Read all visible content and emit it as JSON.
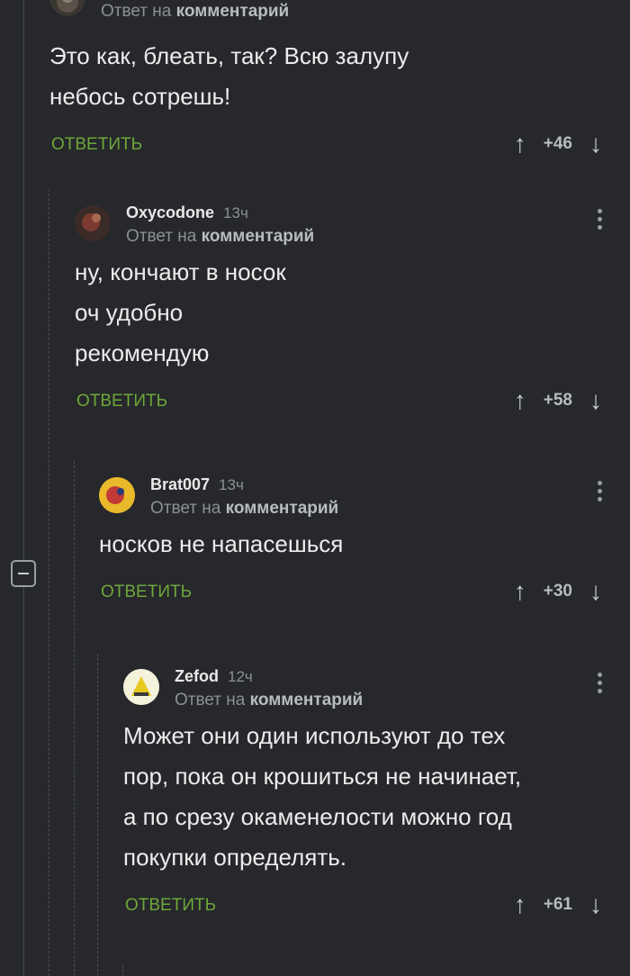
{
  "comments": [
    {
      "author": "",
      "time": "",
      "reply_prefix": "Ответ на",
      "reply_target": "комментарий",
      "body": [
        "Это как, блеать, так? Всю залупу",
        "небось сотрешь!"
      ],
      "reply_label": "ОТВЕТИТЬ",
      "score": "+46"
    },
    {
      "author": "Oxycodone",
      "time": "13ч",
      "reply_prefix": "Ответ на",
      "reply_target": "комментарий",
      "body": [
        "ну, кончают в носок",
        "оч удобно",
        "рекомендую"
      ],
      "reply_label": "ОТВЕТИТЬ",
      "score": "+58"
    },
    {
      "author": "Brat007",
      "time": "13ч",
      "reply_prefix": "Ответ на",
      "reply_target": "комментарий",
      "body": [
        "носков не напасешься"
      ],
      "reply_label": "ОТВЕТИТЬ",
      "score": "+30"
    },
    {
      "author": "Zefod",
      "time": "12ч",
      "reply_prefix": "Ответ на",
      "reply_target": "комментарий",
      "body": [
        "Может они один используют до тех",
        "пор, пока он крошиться не начинает,",
        "а по срезу окаменелости можно год",
        "покупки определять."
      ],
      "reply_label": "ОТВЕТИТЬ",
      "score": "+61"
    }
  ],
  "icons": {
    "upvote": "↑",
    "downvote": "↓"
  },
  "colors": {
    "background": "#26282c",
    "reply_link": "#6fa63a",
    "muted_text": "#8c8f94"
  }
}
